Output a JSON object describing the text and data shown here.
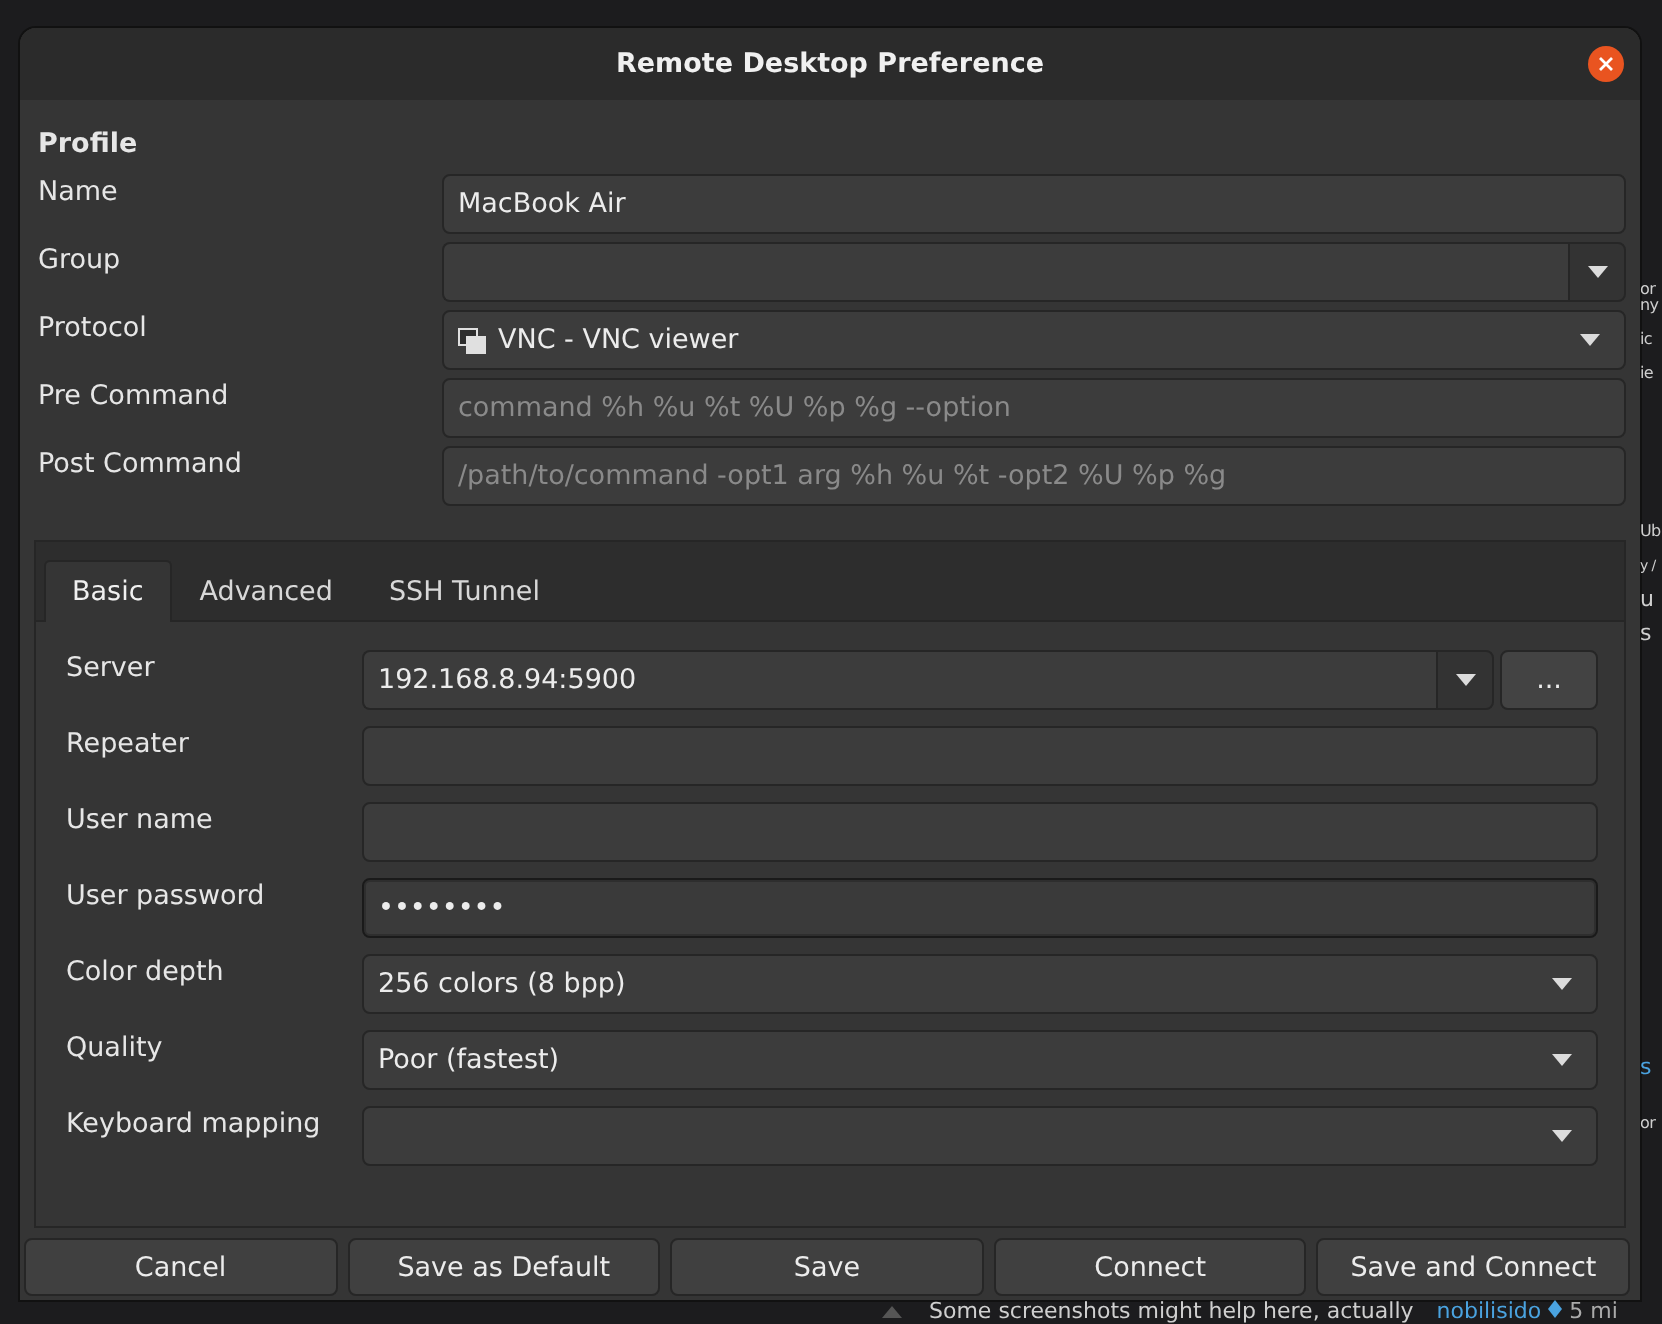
{
  "window": {
    "title": "Remote Desktop Preference"
  },
  "profile": {
    "heading": "Profile",
    "fields": [
      {
        "label": "Name",
        "kind": "entry",
        "value": "MacBook Air"
      },
      {
        "label": "Group",
        "kind": "combo_entry"
      },
      {
        "label": "Protocol",
        "kind": "dropdown",
        "value": "VNC - VNC viewer",
        "icon": true
      },
      {
        "label": "Pre Command",
        "kind": "entry",
        "placeholder": "command %h %u %t %U %p %g --option"
      },
      {
        "label": "Post Command",
        "kind": "entry",
        "placeholder": "/path/to/command -opt1 arg %h %u %t -opt2 %U %p %g"
      }
    ]
  },
  "tabs": [
    {
      "label": "Basic",
      "selected": true
    },
    {
      "label": "Advanced",
      "selected": false
    },
    {
      "label": "SSH Tunnel",
      "selected": false
    }
  ],
  "basic_fields": [
    {
      "label": "Server",
      "kind": "combo_entry",
      "value": "192.168.8.94:5900",
      "button": "..."
    },
    {
      "label": "Repeater",
      "kind": "entry"
    },
    {
      "label": "User name",
      "kind": "entry"
    },
    {
      "label": "User password",
      "kind": "entry",
      "value": "••••••••",
      "focused": true
    },
    {
      "label": "Color depth",
      "kind": "dropdown",
      "value": "256 colors (8 bpp)"
    },
    {
      "label": "Quality",
      "kind": "dropdown",
      "value": "Poor (fastest)"
    },
    {
      "label": "Keyboard mapping",
      "kind": "dropdown"
    }
  ],
  "buttons": [
    "Cancel",
    "Save as Default",
    "Save",
    "Connect",
    "Save and Connect"
  ],
  "background_page": {
    "side_fragments": [
      {
        "text": "or",
        "kind": "text"
      },
      {
        "text": "ny",
        "kind": "text"
      },
      {
        "text": "ic",
        "kind": "text"
      },
      {
        "text": "ie",
        "kind": "text"
      },
      {
        "text": "Ub",
        "kind": "text"
      },
      {
        "text": "y /",
        "kind": "text"
      },
      {
        "text": "u",
        "kind": "text"
      },
      {
        "text": "s",
        "kind": "text"
      },
      {
        "text": "s",
        "kind": "link"
      },
      {
        "text": "or",
        "kind": "text"
      }
    ],
    "comment": {
      "text": "Some screenshots might help here, actually",
      "author": "nobilisido",
      "time": "5 mi"
    }
  }
}
